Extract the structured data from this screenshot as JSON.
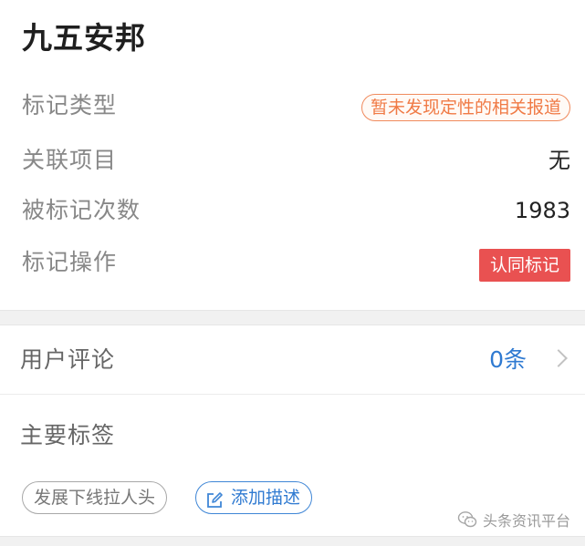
{
  "header": {
    "title": "九五安邦"
  },
  "fields": {
    "mark_type_label": "标记类型",
    "mark_type_value": "暂未发现定性的相关报道",
    "related_project_label": "关联项目",
    "related_project_value": "无",
    "mark_count_label": "被标记次数",
    "mark_count_value": "1983",
    "mark_action_label": "标记操作",
    "mark_action_button": "认同标记"
  },
  "comments": {
    "label": "用户评论",
    "count": "0条"
  },
  "tags": {
    "label": "主要标签",
    "items": [
      "发展下线拉人头"
    ],
    "add_label": "添加描述"
  },
  "watermark": {
    "text": "头条资讯平台"
  },
  "colors": {
    "accent_blue": "#2f7ad1",
    "badge_orange": "#f07a45",
    "button_red": "#e95151"
  }
}
